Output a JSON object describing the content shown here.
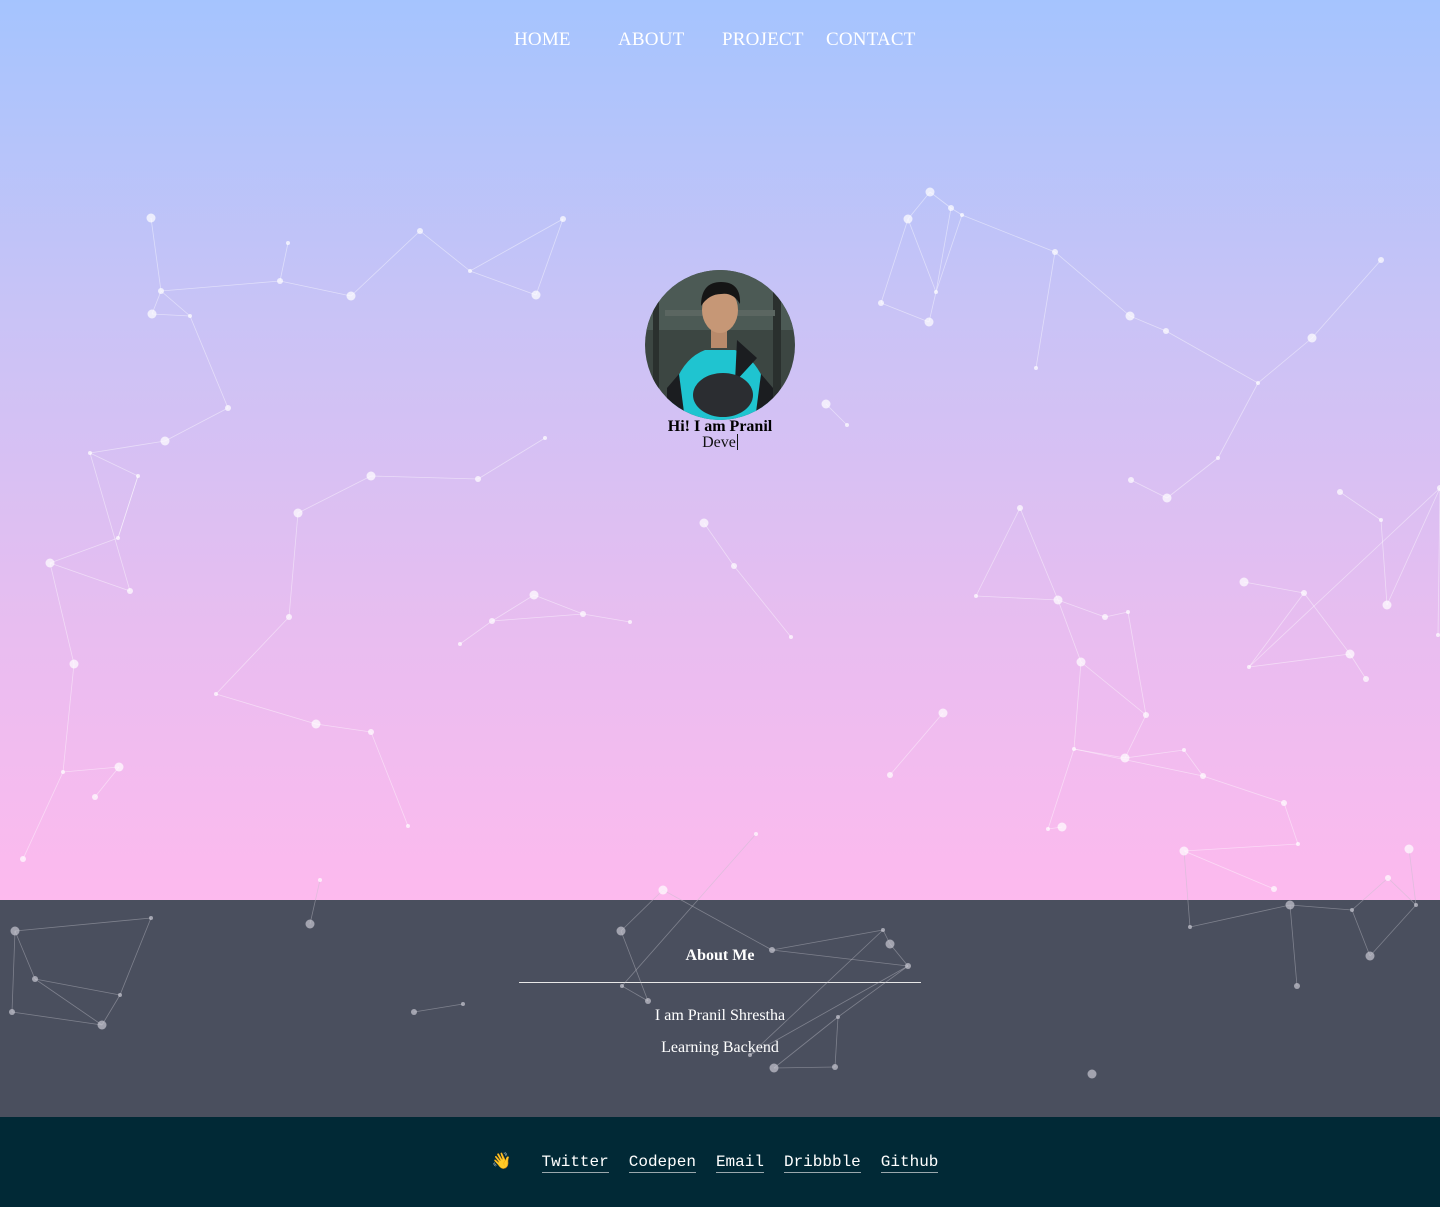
{
  "nav": {
    "items": [
      {
        "label": "HOME"
      },
      {
        "label": "ABOUT"
      },
      {
        "label": "PROJECT"
      },
      {
        "label": "CONTACT"
      }
    ]
  },
  "hero": {
    "greeting": "Hi! I am Pranil",
    "typed_text": "Deve"
  },
  "about": {
    "title": "About Me",
    "lines": [
      "I am Pranil Shrestha",
      "Learning Backend"
    ]
  },
  "footer": {
    "wave": "👋",
    "links": [
      "Twitter",
      "Codepen",
      "Email",
      "Dribbble",
      "Github"
    ]
  },
  "colors": {
    "gradient_top": "#a5c4fe",
    "gradient_bottom": "#fdbaee",
    "about_bg": "#4a4f5e",
    "footer_bg": "#012936",
    "text_light": "#ffffff"
  }
}
